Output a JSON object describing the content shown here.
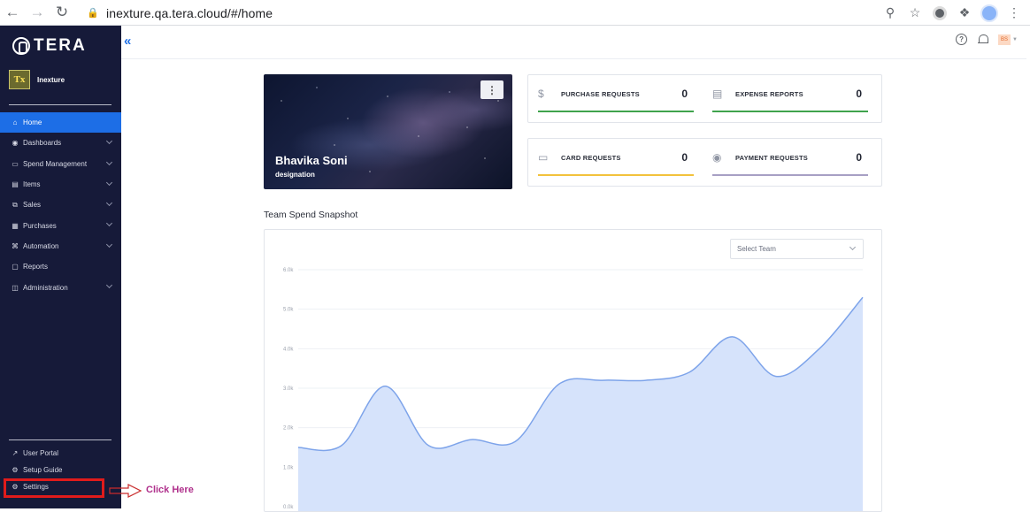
{
  "browser": {
    "url": "inexture.qa.tera.cloud/#/home"
  },
  "sidebar": {
    "logo_text": "TERA",
    "org_avatar": "Tx",
    "org_name": "Inexture",
    "items": [
      {
        "label": "Home",
        "icon": "home-icon",
        "active": true
      },
      {
        "label": "Dashboards",
        "icon": "dashboard-icon",
        "expandable": true
      },
      {
        "label": "Spend Management",
        "icon": "wallet-icon",
        "expandable": true
      },
      {
        "label": "Items",
        "icon": "items-icon",
        "expandable": true
      },
      {
        "label": "Sales",
        "icon": "sales-icon",
        "expandable": true
      },
      {
        "label": "Purchases",
        "icon": "purchases-icon",
        "expandable": true
      },
      {
        "label": "Automation",
        "icon": "automation-icon",
        "expandable": true
      },
      {
        "label": "Reports",
        "icon": "reports-icon"
      },
      {
        "label": "Administration",
        "icon": "administration-icon",
        "expandable": true
      }
    ],
    "bottom_items": [
      {
        "label": "User Portal",
        "icon": "external-link-icon"
      },
      {
        "label": "Setup Guide",
        "icon": "guide-icon"
      },
      {
        "label": "Settings",
        "icon": "gear-icon"
      }
    ]
  },
  "annotation": {
    "text": "Click Here",
    "color": "#b0318c"
  },
  "header": {
    "user_initials": "BS"
  },
  "profile_card": {
    "name": "Bhavika Soni",
    "designation": "designation"
  },
  "stats": [
    [
      {
        "label": "PURCHASE REQUESTS",
        "value": "0",
        "icon": "dollar-icon",
        "color": "#3fa34d"
      },
      {
        "label": "EXPENSE REPORTS",
        "value": "0",
        "icon": "receipt-icon",
        "color": "#3fa34d"
      }
    ],
    [
      {
        "label": "CARD REQUESTS",
        "value": "0",
        "icon": "credit-card-icon",
        "color": "#f2c23c"
      },
      {
        "label": "PAYMENT REQUESTS",
        "value": "0",
        "icon": "cash-icon",
        "color": "#a7a0c4"
      }
    ]
  ],
  "team_spend": {
    "title": "Team Spend Snapshot",
    "select_placeholder": "Select Team"
  },
  "chart_data": {
    "type": "area",
    "yticks": [
      "6.0k",
      "5.0k",
      "4.0k",
      "3.0k",
      "2.0k",
      "1.0k",
      "0.0k"
    ],
    "ylim": [
      0,
      6000
    ],
    "x": [
      0,
      1,
      2,
      3,
      4,
      5,
      6,
      7,
      8,
      9,
      10,
      11,
      12,
      13
    ],
    "values": [
      1500,
      1550,
      3050,
      1550,
      1700,
      1650,
      3100,
      3200,
      3200,
      3400,
      4300,
      3300,
      4000,
      5300
    ],
    "fill_color": "#d6e3fb",
    "line_color": "#7ea4ea"
  }
}
